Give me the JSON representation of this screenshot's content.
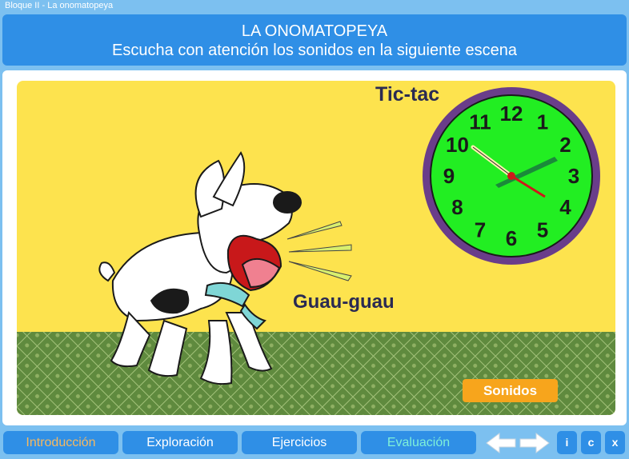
{
  "window": {
    "title": "Bloque II - La onomatopeya"
  },
  "header": {
    "title": "LA ONOMATOPEYA",
    "subtitle": "Escucha con atención los sonidos en la siguiente escena"
  },
  "scene": {
    "clock_label": "Tic-tac",
    "dog_label": "Guau-guau",
    "clock_numbers": [
      "12",
      "1",
      "2",
      "3",
      "4",
      "5",
      "6",
      "7",
      "8",
      "9",
      "10",
      "11"
    ],
    "sounds_button": "Sonidos",
    "colors": {
      "sky": "#fde34e",
      "grass": "#5f8a3e",
      "clock_face": "#22ee22",
      "clock_rim": "#6a3d8a"
    }
  },
  "nav": {
    "tabs": [
      "Introducción",
      "Exploración",
      "Ejercicios",
      "Evaluación"
    ],
    "icons": [
      "arrow-left-icon",
      "arrow-right-icon"
    ],
    "info": "i",
    "credits": "c",
    "close": "x"
  }
}
